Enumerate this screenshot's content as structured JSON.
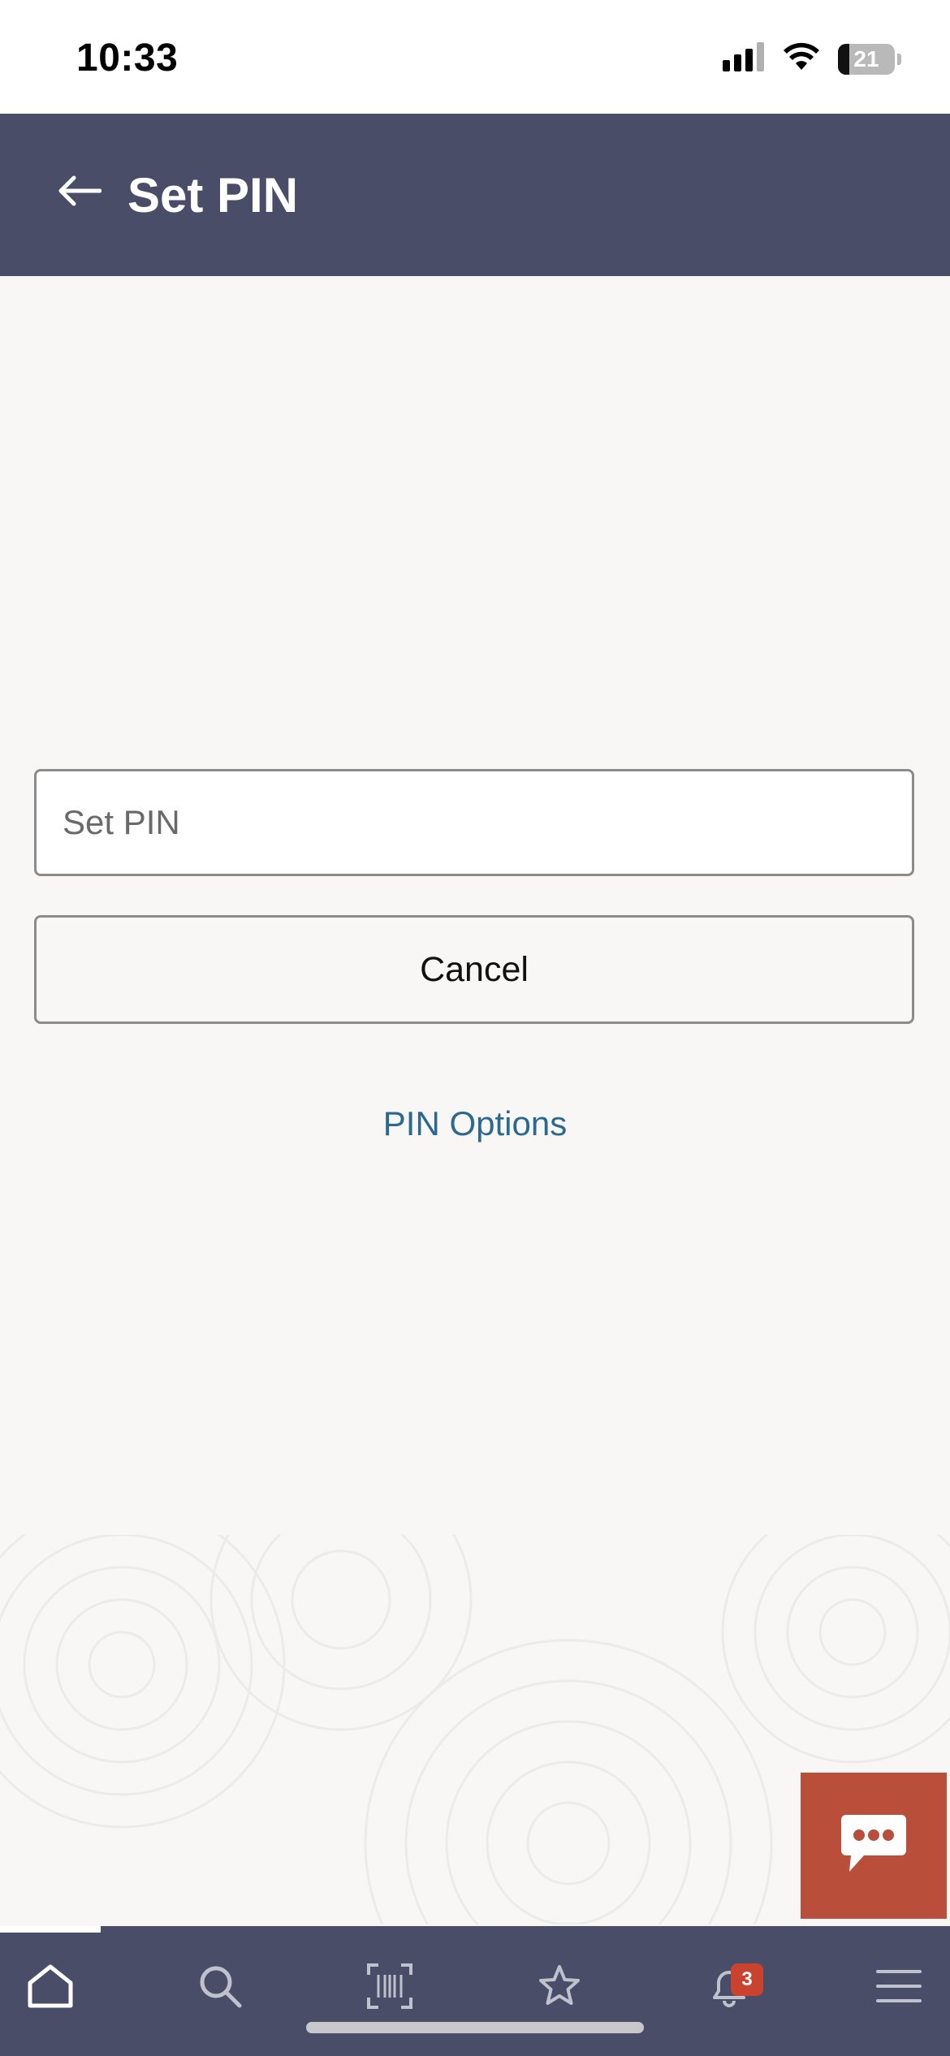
{
  "status_bar": {
    "time": "10:33",
    "battery": "21",
    "icons": [
      "signal-icon",
      "wifi-icon",
      "battery-icon"
    ]
  },
  "header": {
    "title": "Set PIN",
    "back_icon": "arrow-left-icon",
    "background": "#494d67"
  },
  "form": {
    "pin_placeholder": "Set PIN",
    "pin_value": "",
    "cancel_label": "Cancel",
    "options_link": "PIN Options"
  },
  "chat": {
    "icon": "chat-bubble-icon",
    "color": "#b94e3b"
  },
  "bottom_nav": {
    "items": [
      {
        "icon": "home-icon",
        "active": true
      },
      {
        "icon": "search-icon",
        "active": false
      },
      {
        "icon": "barcode-scan-icon",
        "active": false
      },
      {
        "icon": "star-icon",
        "active": false
      },
      {
        "icon": "bell-icon",
        "active": false
      },
      {
        "icon": "menu-icon",
        "active": false
      }
    ],
    "notification_count": "3"
  },
  "colors": {
    "accent_link": "#2b6a8e",
    "badge": "#c9432f",
    "page_background": "#f8f7f6"
  }
}
